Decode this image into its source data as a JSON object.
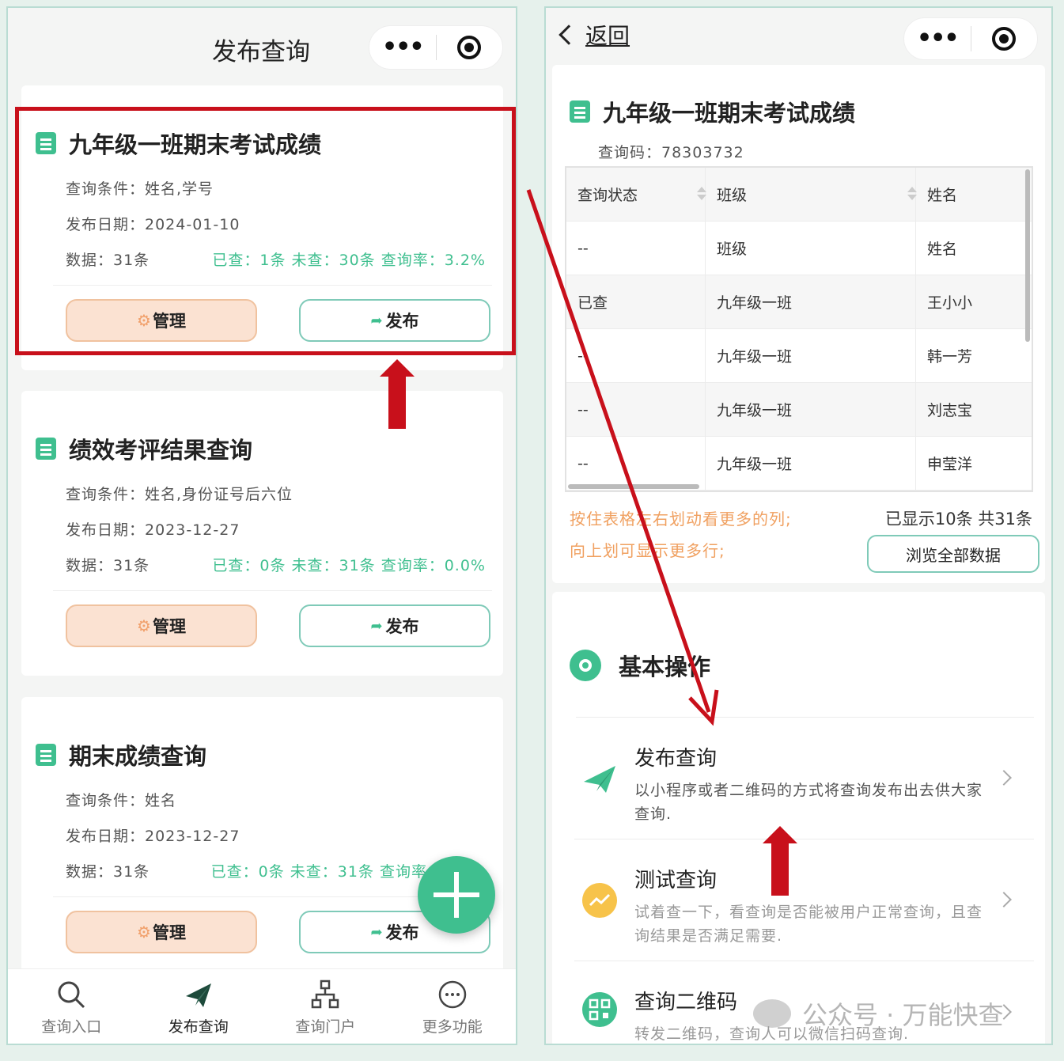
{
  "left": {
    "nav_title": "发布查询",
    "cards": [
      {
        "title": "九年级一班期末考试成绩",
        "conditions": "查询条件：姓名,学号",
        "date": "发布日期：2024-01-10",
        "count": "数据：31条",
        "stats": "已查：1条 未查：30条 查询率：3.2%",
        "manage": "管理",
        "publish": "发布"
      },
      {
        "title": "绩效考评结果查询",
        "conditions": "查询条件：姓名,身份证号后六位",
        "date": "发布日期：2023-12-27",
        "count": "数据：31条",
        "stats": "已查：0条 未查：31条 查询率：0.0%",
        "manage": "管理",
        "publish": "发布"
      },
      {
        "title": "期末成绩查询",
        "conditions": "查询条件：姓名",
        "date": "发布日期：2023-12-27",
        "count": "数据：31条",
        "stats": "已查：0条 未查：31条 查询率",
        "manage": "管理",
        "publish": "发布"
      }
    ],
    "tabs": [
      "查询入口",
      "发布查询",
      "查询门户",
      "更多功能"
    ],
    "active_tab": "发布查询"
  },
  "right": {
    "back": "返回",
    "title": "九年级一班期末考试成绩",
    "code": "查询码：78303732",
    "table": {
      "headers": [
        "查询状态",
        "班级",
        "姓名"
      ],
      "rows": [
        [
          "--",
          "班级",
          "姓名"
        ],
        [
          "已查",
          "九年级一班",
          "王小小"
        ],
        [
          "--",
          "九年级一班",
          "韩一芳"
        ],
        [
          "--",
          "九年级一班",
          "刘志宝"
        ],
        [
          "--",
          "九年级一班",
          "申莹洋"
        ]
      ]
    },
    "hint1": "按住表格左右划动看更多的列;",
    "hint2": "向上划可显示更多行;",
    "shown": "已显示10条 共31条",
    "browse": "浏览全部数据",
    "section_title": "基本操作",
    "items": [
      {
        "name": "发布查询",
        "desc": "以小程序或者二维码的方式将查询发布出去供大家查询."
      },
      {
        "name": "测试查询",
        "desc": "试着查一下，看查询是否能被用户正常查询，且查询结果是否满足需要."
      },
      {
        "name": "查询二维码",
        "desc": "转发二维码，查询人可以微信扫码查询."
      }
    ]
  },
  "watermark": "公众号 · 万能快查",
  "colors": {
    "accent": "#3fbf8f",
    "annotation": "#c8101b",
    "manage_bg": "#fbe2d2",
    "hint": "#f0a060"
  }
}
